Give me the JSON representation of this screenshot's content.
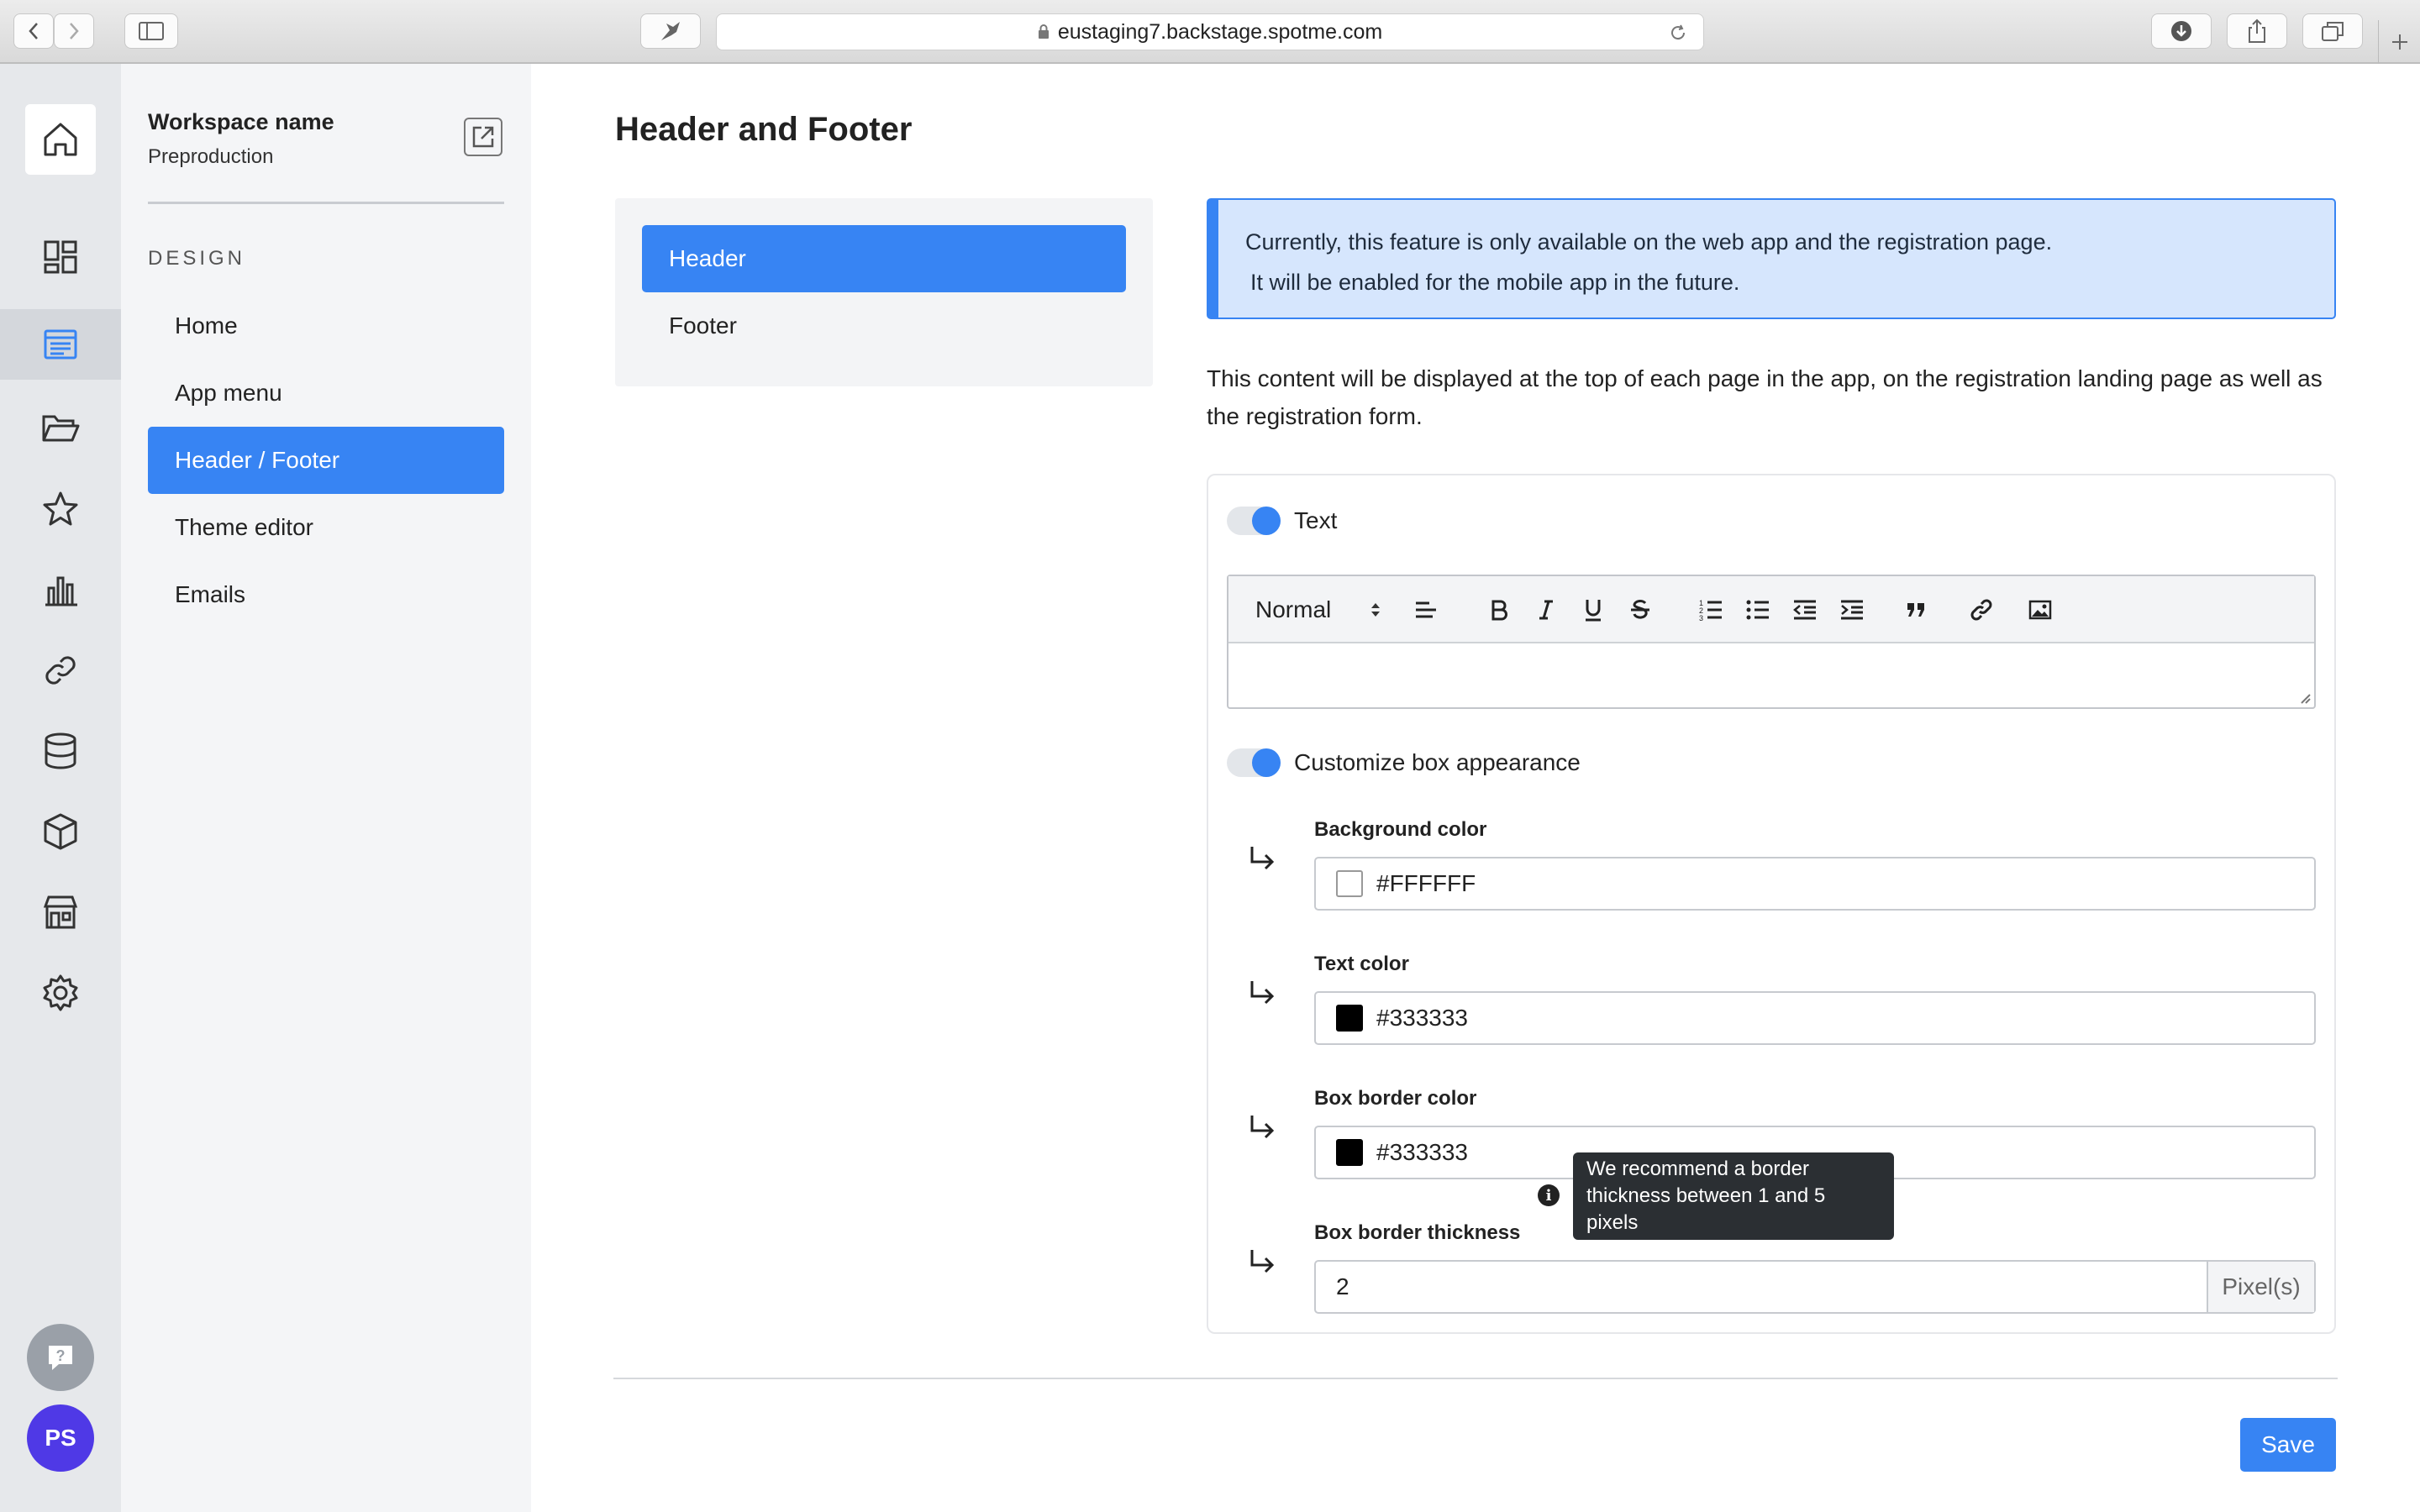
{
  "browser": {
    "url": "eustaging7.backstage.spotme.com"
  },
  "workspace": {
    "name": "Workspace name",
    "subtitle": "Preproduction"
  },
  "sidebar": {
    "section_label": "DESIGN",
    "items": [
      {
        "label": "Home"
      },
      {
        "label": "App menu"
      },
      {
        "label": "Header / Footer",
        "active": true
      },
      {
        "label": "Theme editor"
      },
      {
        "label": "Emails"
      }
    ]
  },
  "rail": {
    "icons": [
      "home-icon",
      "dashboard-icon",
      "design-icon",
      "folder-icon",
      "star-icon",
      "analytics-icon",
      "link-icon",
      "database-icon",
      "package-icon",
      "store-icon",
      "settings-icon"
    ],
    "avatar_initials": "PS"
  },
  "page": {
    "title": "Header and Footer",
    "subnav": [
      {
        "label": "Header",
        "active": true
      },
      {
        "label": "Footer"
      }
    ],
    "alert_line1": "Currently, this feature is only available on the web app and the registration page.",
    "alert_line2": "It will be enabled for the mobile app in the future.",
    "description": "This content will be displayed at the top of each page in the app, on the registration landing page as well as the registration form.",
    "text_toggle_label": "Text",
    "editor_format": "Normal",
    "customize_toggle_label": "Customize box appearance",
    "fields": {
      "background_color": {
        "label": "Background color",
        "value": "#FFFFFF"
      },
      "text_color": {
        "label": "Text color",
        "value": "#333333"
      },
      "border_color": {
        "label": "Box border color",
        "value": "#333333"
      },
      "border_thickness": {
        "label": "Box border thickness",
        "value": "2",
        "unit": "Pixel(s)"
      }
    },
    "tooltip": "We recommend a border thickness between 1 and 5 pixels",
    "save_label": "Save"
  },
  "colors": {
    "accent": "#3784f3",
    "avatar": "#4f39e6"
  }
}
